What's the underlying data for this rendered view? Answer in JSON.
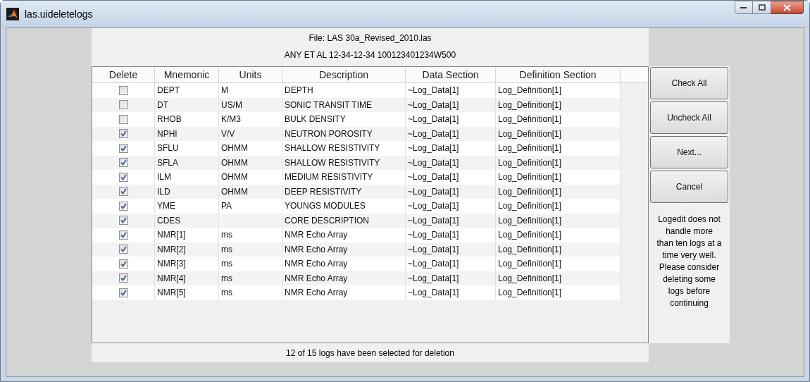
{
  "window": {
    "title": "las.uideletelogs"
  },
  "file_line": "File: LAS 30a_Revised_2010.las",
  "well_line": "ANY ET AL 12-34-12-34 100123401234W500",
  "table": {
    "columns": [
      "Delete",
      "Mnemonic",
      "Units",
      "Description",
      "Data Section",
      "Definition Section"
    ],
    "rows": [
      {
        "checked": false,
        "mnemonic": "DEPT",
        "units": "M",
        "description": "DEPTH",
        "data_section": "~Log_Data[1]",
        "definition_section": "Log_Definition[1]"
      },
      {
        "checked": false,
        "mnemonic": "DT",
        "units": "US/M",
        "description": "SONIC TRANSIT TIME",
        "data_section": "~Log_Data[1]",
        "definition_section": "Log_Definition[1]"
      },
      {
        "checked": false,
        "mnemonic": "RHOB",
        "units": "K/M3",
        "description": "BULK DENSITY",
        "data_section": "~Log_Data[1]",
        "definition_section": "Log_Definition[1]"
      },
      {
        "checked": true,
        "mnemonic": "NPHI",
        "units": "V/V",
        "description": "NEUTRON POROSITY",
        "data_section": "~Log_Data[1]",
        "definition_section": "Log_Definition[1]"
      },
      {
        "checked": true,
        "mnemonic": "SFLU",
        "units": "OHMM",
        "description": "SHALLOW RESISTIVITY",
        "data_section": "~Log_Data[1]",
        "definition_section": "Log_Definition[1]"
      },
      {
        "checked": true,
        "mnemonic": "SFLA",
        "units": "OHMM",
        "description": "SHALLOW RESISTIVITY",
        "data_section": "~Log_Data[1]",
        "definition_section": "Log_Definition[1]"
      },
      {
        "checked": true,
        "mnemonic": "ILM",
        "units": "OHMM",
        "description": "MEDIUM RESISTIVITY",
        "data_section": "~Log_Data[1]",
        "definition_section": "Log_Definition[1]"
      },
      {
        "checked": true,
        "mnemonic": "ILD",
        "units": "OHMM",
        "description": "DEEP RESISTIVITY",
        "data_section": "~Log_Data[1]",
        "definition_section": "Log_Definition[1]"
      },
      {
        "checked": true,
        "mnemonic": "YME",
        "units": "PA",
        "description": "YOUNGS MODULES",
        "data_section": "~Log_Data[1]",
        "definition_section": "Log_Definition[1]"
      },
      {
        "checked": true,
        "mnemonic": "CDES",
        "units": "",
        "description": "CORE DESCRIPTION",
        "data_section": "~Log_Data[1]",
        "definition_section": "Log_Definition[1]"
      },
      {
        "checked": true,
        "mnemonic": "NMR[1]",
        "units": "ms",
        "description": "NMR Echo Array",
        "data_section": "~Log_Data[1]",
        "definition_section": "Log_Definition[1]"
      },
      {
        "checked": true,
        "mnemonic": "NMR[2]",
        "units": "ms",
        "description": "NMR Echo Array",
        "data_section": "~Log_Data[1]",
        "definition_section": "Log_Definition[1]"
      },
      {
        "checked": true,
        "mnemonic": "NMR[3]",
        "units": "ms",
        "description": "NMR Echo Array",
        "data_section": "~Log_Data[1]",
        "definition_section": "Log_Definition[1]"
      },
      {
        "checked": true,
        "mnemonic": "NMR[4]",
        "units": "ms",
        "description": "NMR Echo Array",
        "data_section": "~Log_Data[1]",
        "definition_section": "Log_Definition[1]"
      },
      {
        "checked": true,
        "mnemonic": "NMR[5]",
        "units": "ms",
        "description": "NMR Echo Array",
        "data_section": "~Log_Data[1]",
        "definition_section": "Log_Definition[1]"
      }
    ]
  },
  "buttons": [
    "Check All",
    "Uncheck All",
    "Next...",
    "Cancel"
  ],
  "note": "Logedit does not handle more than ten logs at a time very well. Please consider deleting some logs before continuing",
  "status": "12 of 15 logs have been selected for deletion"
}
